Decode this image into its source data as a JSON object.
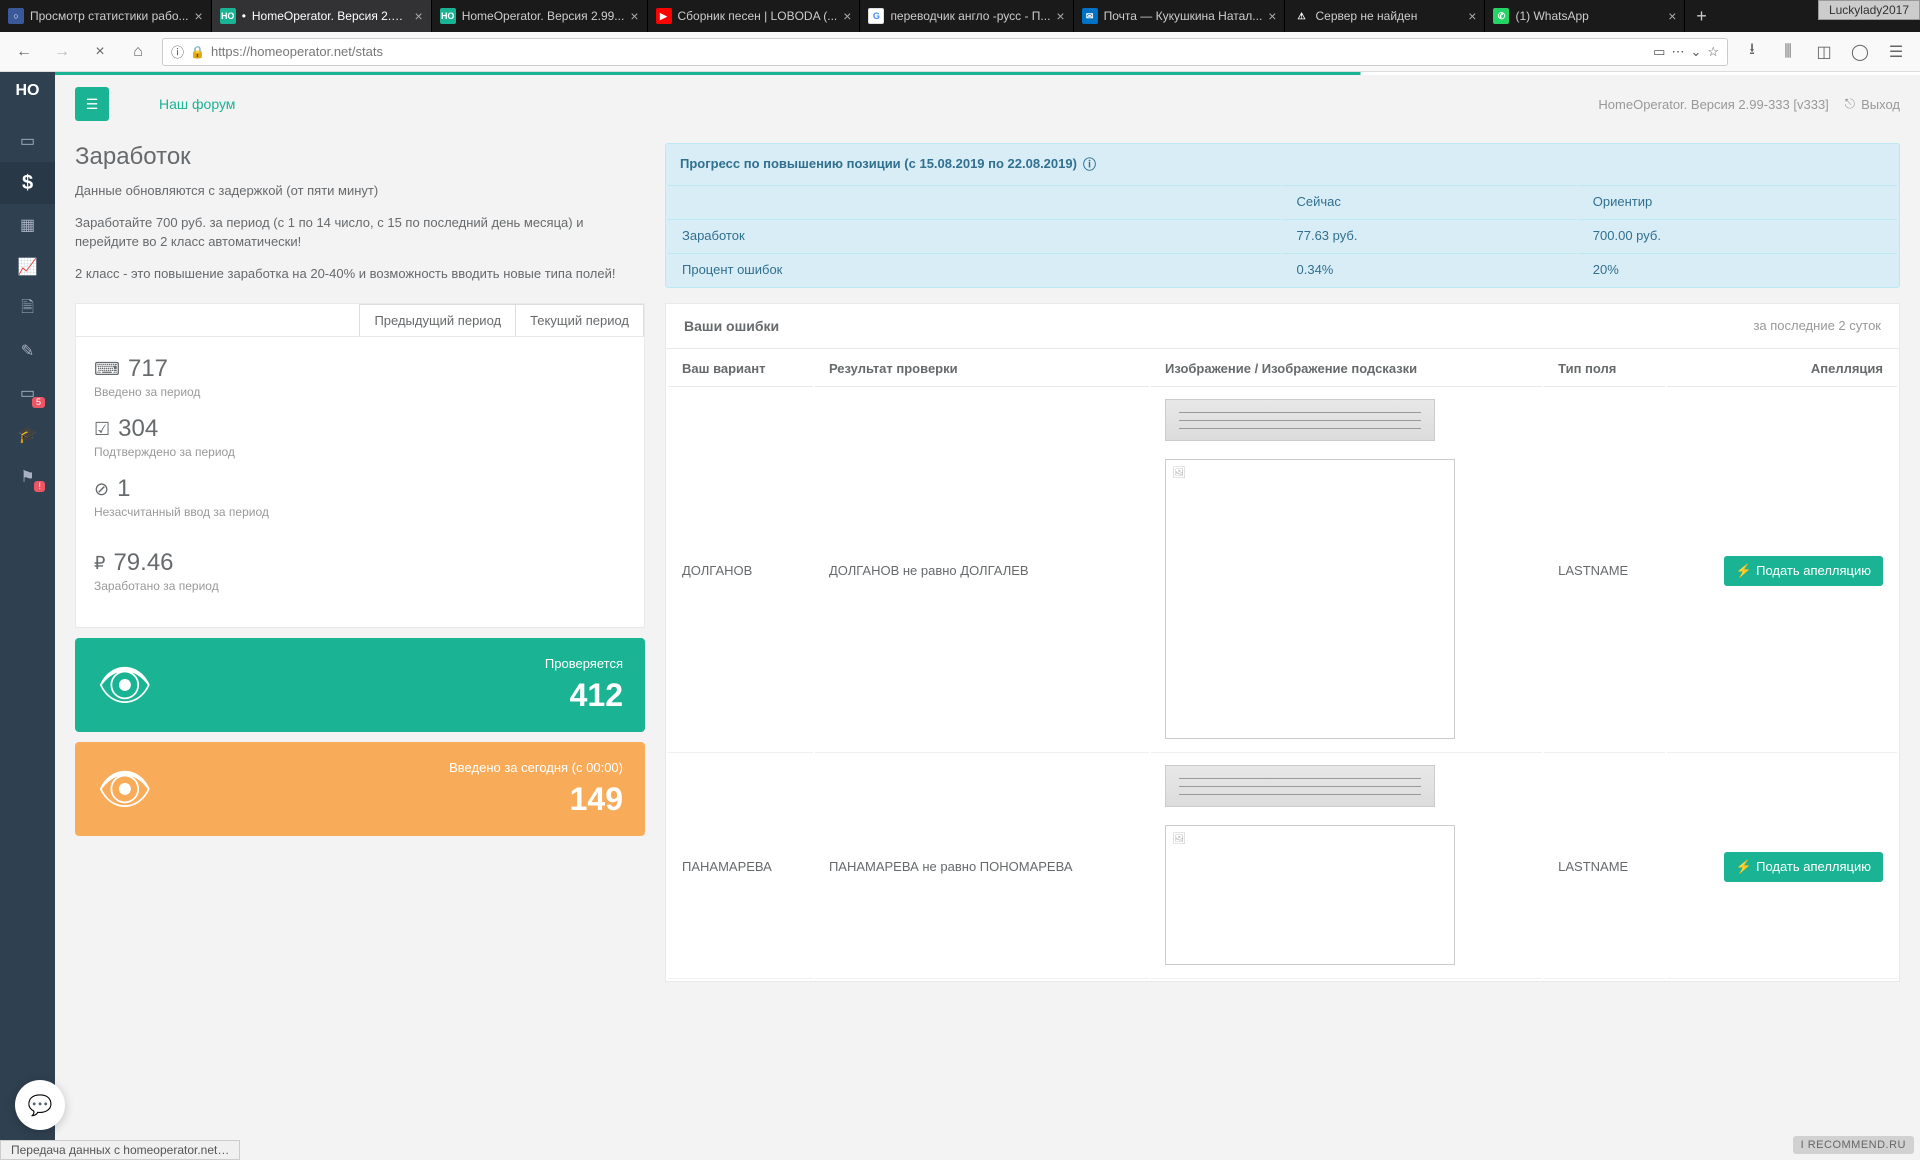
{
  "browser": {
    "tabs": [
      {
        "title": "Просмотр статистики рабо...",
        "favicon_bg": "#3b5998",
        "favicon_txt": "○"
      },
      {
        "title": "HomeOperator. Версия 2.99...",
        "favicon_bg": "#1ab394",
        "favicon_txt": "HO",
        "active": true,
        "bullet": "•"
      },
      {
        "title": "HomeOperator. Версия 2.99...",
        "favicon_bg": "#1ab394",
        "favicon_txt": "HO"
      },
      {
        "title": "Сборник песен | LOBODA (...",
        "favicon_bg": "#ff0000",
        "favicon_txt": "▶"
      },
      {
        "title": "переводчик англо -русс - П...",
        "favicon_bg": "#fff",
        "favicon_txt": "G"
      },
      {
        "title": "Почта — Кукушкина Натал...",
        "favicon_bg": "#0072c6",
        "favicon_txt": "✉"
      },
      {
        "title": "Сервер не найден",
        "favicon_bg": "#333",
        "favicon_txt": "⚠"
      },
      {
        "title": "(1) WhatsApp",
        "favicon_bg": "#25d366",
        "favicon_txt": "●"
      }
    ],
    "user_badge": "Luckylady2017",
    "url": "https://homeoperator.net/stats",
    "status_bar": "Передача данных с homeoperator.net…"
  },
  "sidebar": {
    "logo": "HO",
    "items": [
      {
        "icon": "▭"
      },
      {
        "icon": "$",
        "active": true
      },
      {
        "icon": "▦"
      },
      {
        "icon": "📈"
      },
      {
        "icon": "📄"
      },
      {
        "icon": "✎"
      },
      {
        "icon": "▭",
        "badge": "5"
      },
      {
        "icon": "🎓"
      },
      {
        "icon": "⚑",
        "badge": "!"
      }
    ]
  },
  "header": {
    "forum": "Наш форум",
    "version": "HomeOperator. Версия 2.99-333 [v333]",
    "logout": "Выход"
  },
  "page": {
    "title": "Заработок",
    "desc1": "Данные обновляются с задержкой (от пяти минут)",
    "desc2": "Заработайте 700 руб. за период (с 1 по 14 число, с 15 по последний день месяца) и перейдите во 2 класс автоматически!",
    "desc3": "2 класс - это повышение заработка на 20-40% и возможность вводить новые типа полей!"
  },
  "progress": {
    "title": "Прогресс по повышению позиции (с 15.08.2019 по 22.08.2019)",
    "col_now": "Сейчас",
    "col_target": "Ориентир",
    "row1_label": "Заработок",
    "row1_now": "77.63 руб.",
    "row1_target": "700.00 руб.",
    "row2_label": "Процент ошибок",
    "row2_now": "0.34%",
    "row2_target": "20%"
  },
  "periods": {
    "prev": "Предыдущий период",
    "curr": "Текущий период"
  },
  "stats": {
    "entered_val": "717",
    "entered_label": "Введено за период",
    "confirmed_val": "304",
    "confirmed_label": "Подтверждено за период",
    "uncounted_val": "1",
    "uncounted_label": "Незасчитанный ввод за период",
    "earned_val": "79.46",
    "earned_label": "Заработано за период"
  },
  "cards": {
    "checking_label": "Проверяется",
    "checking_val": "412",
    "today_label": "Введено за сегодня (с 00:00)",
    "today_val": "149"
  },
  "errors": {
    "title": "Ваши ошибки",
    "subtitle": "за последние 2 суток",
    "col_variant": "Ваш вариант",
    "col_result": "Результат проверки",
    "col_image": "Изображение / Изображение подсказки",
    "col_type": "Тип поля",
    "col_appeal": "Апелляция",
    "appeal_btn": "Подать апелляцию",
    "rows": [
      {
        "variant": "ДОЛГАНОВ",
        "result": "ДОЛГАНОВ не равно ДОЛГАЛЕВ",
        "type": "LASTNAME"
      },
      {
        "variant": "ПАНАМАРЕВА",
        "result": "ПАНАМАРЕВА не равно ПОНОМАРЕВА",
        "type": "LASTNAME"
      }
    ]
  },
  "watermark": "I RECOMMEND.RU"
}
